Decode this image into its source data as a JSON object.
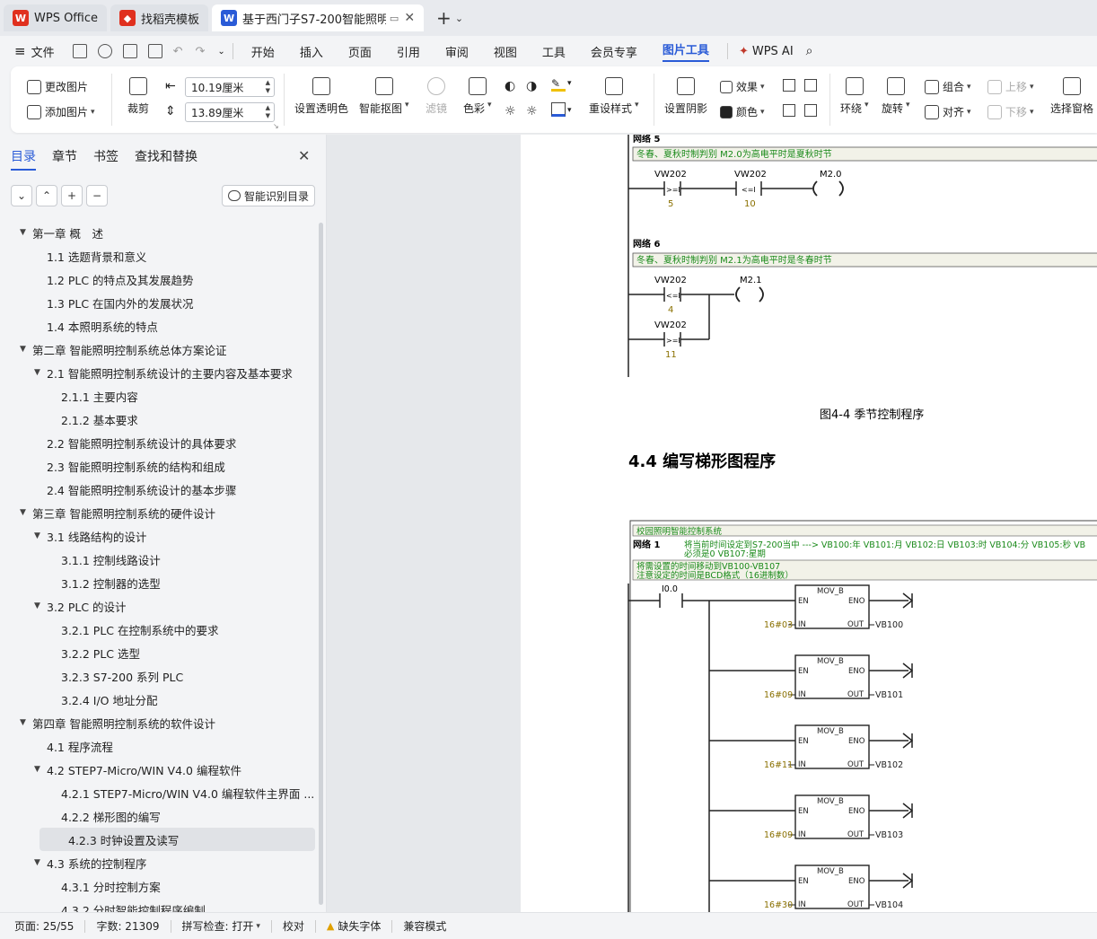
{
  "tabs": [
    {
      "label": "WPS Office",
      "icon": "wps-logo-icon"
    },
    {
      "label": "找稻壳模板",
      "icon": "docer-icon"
    },
    {
      "label": "基于西门子S7-200智能照明控",
      "icon": "word-doc-icon"
    }
  ],
  "menu": {
    "file": "文件",
    "items": [
      "开始",
      "插入",
      "页面",
      "引用",
      "审阅",
      "视图",
      "工具",
      "会员专享",
      "图片工具"
    ],
    "active": "图片工具",
    "wps_ai": "WPS AI"
  },
  "ribbon": {
    "change_picture": "更改图片",
    "add_picture": "添加图片",
    "crop": "裁剪",
    "width": "10.19厘米",
    "height": "13.89厘米",
    "set_transparent": "设置透明色",
    "smart_cutout": "智能抠图",
    "filter": "滤镜",
    "color": "色彩",
    "reset_style": "重设样式",
    "shadow": "设置阴影",
    "effects": "效果",
    "fill_color": "颜色",
    "wrap": "环绕",
    "rotate": "旋转",
    "group": "组合",
    "align": "对齐",
    "move_up": "上移",
    "move_down": "下移",
    "selection_pane": "选择窗格"
  },
  "sidebar": {
    "tabs": [
      "目录",
      "章节",
      "书签",
      "查找和替换"
    ],
    "smart_toc": "智能识别目录",
    "toc": [
      {
        "label": "第一章 概　述",
        "level": 0,
        "expanded": true
      },
      {
        "label": "1.1 选题背景和意义",
        "level": 1
      },
      {
        "label": "1.2 PLC 的特点及其发展趋势",
        "level": 1
      },
      {
        "label": "1.3 PLC 在国内外的发展状况",
        "level": 1
      },
      {
        "label": "1.4 本照明系统的特点",
        "level": 1
      },
      {
        "label": "第二章 智能照明控制系统总体方案论证",
        "level": 0,
        "expanded": true
      },
      {
        "label": "2.1 智能照明控制系统设计的主要内容及基本要求",
        "level": 1,
        "expanded": true
      },
      {
        "label": "2.1.1 主要内容",
        "level": 2
      },
      {
        "label": "2.1.2 基本要求",
        "level": 2
      },
      {
        "label": "2.2 智能照明控制系统设计的具体要求",
        "level": 1
      },
      {
        "label": "2.3 智能照明控制系统的结构和组成",
        "level": 1
      },
      {
        "label": "2.4 智能照明控制系统设计的基本步骤",
        "level": 1
      },
      {
        "label": "第三章 智能照明控制系统的硬件设计",
        "level": 0,
        "expanded": true
      },
      {
        "label": "3.1 线路结构的设计",
        "level": 1,
        "expanded": true
      },
      {
        "label": "3.1.1 控制线路设计",
        "level": 2
      },
      {
        "label": "3.1.2 控制器的选型",
        "level": 2
      },
      {
        "label": "3.2 PLC 的设计",
        "level": 1,
        "expanded": true
      },
      {
        "label": "3.2.1 PLC 在控制系统中的要求",
        "level": 2
      },
      {
        "label": "3.2.2 PLC 选型",
        "level": 2
      },
      {
        "label": "3.2.3 S7-200 系列 PLC",
        "level": 2
      },
      {
        "label": "3.2.4 I/O 地址分配",
        "level": 2
      },
      {
        "label": "第四章 智能照明控制系统的软件设计",
        "level": 0,
        "expanded": true
      },
      {
        "label": "4.1 程序流程",
        "level": 1
      },
      {
        "label": "4.2 STEP7-Micro/WIN V4.0 编程软件",
        "level": 1,
        "expanded": true
      },
      {
        "label": "4.2.1 STEP7-Micro/WIN V4.0 编程软件主界面 ...",
        "level": 2
      },
      {
        "label": "4.2.2 梯形图的编写",
        "level": 2
      },
      {
        "label": "4.2.3 时钟设置及读写",
        "level": 2,
        "selected": true
      },
      {
        "label": "4.3 系统的控制程序",
        "level": 1,
        "expanded": true
      },
      {
        "label": "4.3.1 分时控制方案",
        "level": 2
      },
      {
        "label": "4.3.2 分时智能控制程序编制",
        "level": 2
      }
    ]
  },
  "document": {
    "net5_label": "网络 5",
    "net5_comment": "冬春、夏秋时制判别 M2.0为高电平时是夏秋时节",
    "net5_c1": "VW202",
    "net5_c1_op": ">=I",
    "net5_c1_val": "5",
    "net5_c2": "VW202",
    "net5_c2_op": "<=I",
    "net5_c2_val": "10",
    "net5_coil": "M2.0",
    "net6_label": "网络 6",
    "net6_comment": "冬春、夏秋时制判别 M2.1为高电平时是冬春时节",
    "net6_c1": "VW202",
    "net6_c1_op": "<=I",
    "net6_c1_val": "4",
    "net6_c2": "VW202",
    "net6_c2_op": ">=I",
    "net6_c2_val": "11",
    "net6_coil": "M2.1",
    "figure_caption": "图4-4 季节控制程序",
    "section_heading": "4.4 编写梯形图程序",
    "program_title": "校园照明智能控制系统",
    "net1_label": "网络 1",
    "net1_comment_a": "将当前时间设定到S7-200当中 ---> VB100:年 VB101:月 VB102:日 VB103:时 VB104:分 VB105:秒 VB",
    "net1_comment_b": "必须是0 VB107:星期",
    "net1_note_a": "将需设置的时间移动到VB100-VB107",
    "net1_note_b": "注意设定的时间是BCD格式（16进制数）",
    "input_contact": "I0.0",
    "block_name": "MOV_B",
    "pin_en": "EN",
    "pin_eno": "ENO",
    "pin_in": "IN",
    "pin_out": "OUT",
    "mov_blocks": [
      {
        "in": "16#03",
        "out": "VB100"
      },
      {
        "in": "16#09",
        "out": "VB101"
      },
      {
        "in": "16#11",
        "out": "VB102"
      },
      {
        "in": "16#09",
        "out": "VB103"
      },
      {
        "in": "16#30",
        "out": "VB104"
      }
    ]
  },
  "status": {
    "page": "页面: 25/55",
    "words": "字数: 21309",
    "spell": "拼写检查: 打开",
    "proof": "校对",
    "missing_font": "缺失字体",
    "compat": "兼容模式"
  },
  "colors": {
    "accent": "#2a5bd7",
    "comment_text": "#1a8a1a",
    "value_text": "#8a7000",
    "comment_bg": "#f2f2e8"
  }
}
